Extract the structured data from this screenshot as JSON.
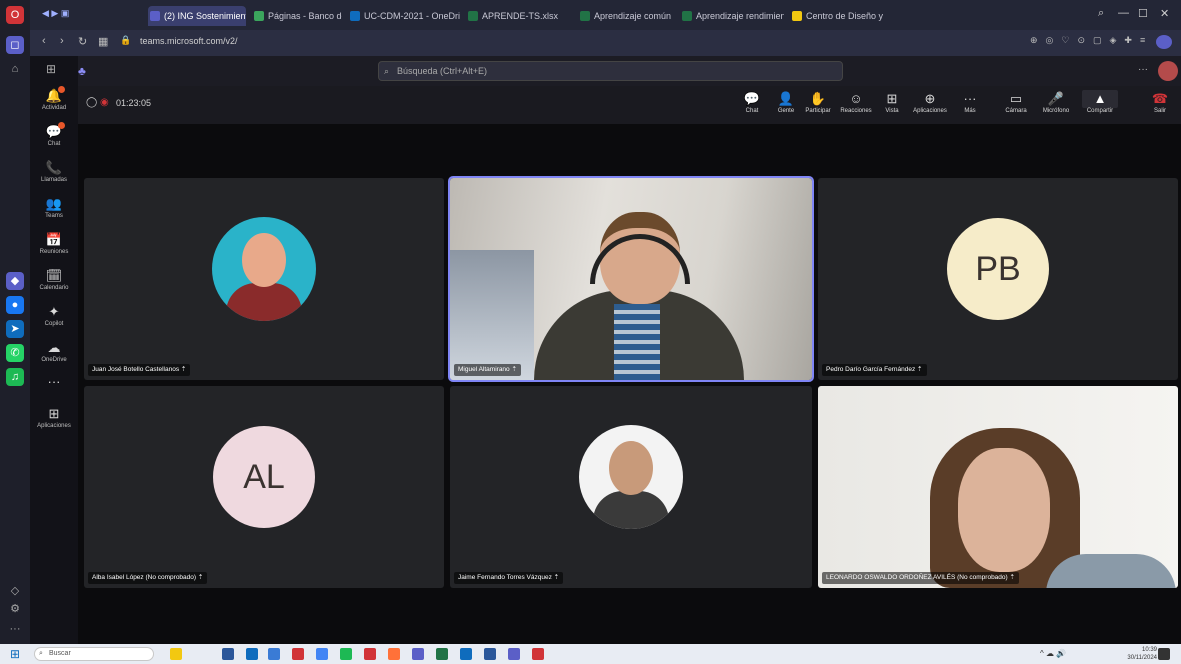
{
  "browser": {
    "tabs": [
      {
        "label": "(2) ING Sostenimiento pri",
        "color": "#5b5fc7",
        "active": true
      },
      {
        "label": "Páginas - Banco de Instru",
        "color": "#3ba55d",
        "active": false
      },
      {
        "label": "UC-CDM-2021 - OneDrive",
        "color": "#0f6cbd",
        "active": false
      },
      {
        "label": "APRENDE-TS.xlsx",
        "color": "#217346",
        "active": false
      },
      {
        "label": "Aprendizaje común Interd",
        "color": "#217346",
        "active": false
      },
      {
        "label": "Aprendizaje rendimiento",
        "color": "#217346",
        "active": false
      },
      {
        "label": "Centro de Diseño y Metro",
        "color": "#f2c811",
        "active": false
      }
    ],
    "url": "teams.microsoft.com/v2/",
    "window_controls": [
      "—",
      "☐",
      "✕"
    ]
  },
  "teams": {
    "search_placeholder": "Búsqueda (Ctrl+Alt+E)",
    "rail": [
      {
        "label": "Actividad",
        "icon": "🔔",
        "badge": true
      },
      {
        "label": "Chat",
        "icon": "💬",
        "badge": true
      },
      {
        "label": "Llamadas",
        "icon": "📞",
        "badge": false
      },
      {
        "label": "Teams",
        "icon": "👥",
        "badge": false
      },
      {
        "label": "Reuniones",
        "icon": "📅",
        "badge": false
      },
      {
        "label": "Calendario",
        "icon": "🗓",
        "badge": false
      },
      {
        "label": "Copilot",
        "icon": "✦",
        "badge": false
      },
      {
        "label": "OneDrive",
        "icon": "☁",
        "badge": false
      },
      {
        "label": "",
        "icon": "···",
        "badge": false
      },
      {
        "label": "Aplicaciones",
        "icon": "⊞",
        "badge": false
      }
    ]
  },
  "meeting": {
    "timer": "01:23:05",
    "toolbar": [
      {
        "label": "Chat",
        "icon": "💬"
      },
      {
        "label": "Gente",
        "icon": "👤"
      },
      {
        "label": "Participar",
        "icon": "✋"
      },
      {
        "label": "Reacciones",
        "icon": "☺"
      },
      {
        "label": "Vista",
        "icon": "⊞"
      },
      {
        "label": "Aplicaciones",
        "icon": "⊕"
      },
      {
        "label": "Más",
        "icon": "···"
      },
      {
        "label": "Cámara",
        "icon": "▭"
      },
      {
        "label": "Micrófono",
        "icon": "🎤"
      },
      {
        "label": "Compartir",
        "icon": "▲"
      },
      {
        "label": "Salir",
        "icon": "☎"
      }
    ],
    "participants": [
      {
        "name": "Juan José Botello Castellanos",
        "type": "photo",
        "photo_colors": [
          "#2ab3c9",
          "#8a2b2b",
          "#e8a98a"
        ]
      },
      {
        "name": "Miguel Altamirano",
        "type": "video",
        "speaking": true
      },
      {
        "name": "Pedro Darío García Fernández",
        "type": "initials",
        "initials": "PB",
        "bg": "#f6ecc9"
      },
      {
        "name": "Alba Isabel López (No comprobado)",
        "type": "initials",
        "initials": "AL",
        "bg": "#efd9df"
      },
      {
        "name": "Jaime Fernando Torres Vázquez",
        "type": "photo",
        "photo_colors": [
          "#f3f3f3",
          "#3a3a3a",
          "#c89a7a"
        ]
      },
      {
        "name": "LEONARDO OSWALDO ORDOÑEZ AVILÉS (No comprobado)",
        "type": "video2"
      }
    ]
  },
  "taskbar": {
    "search_placeholder": "Buscar",
    "tray_time": "10:39",
    "tray_date": "30/11/2024"
  }
}
